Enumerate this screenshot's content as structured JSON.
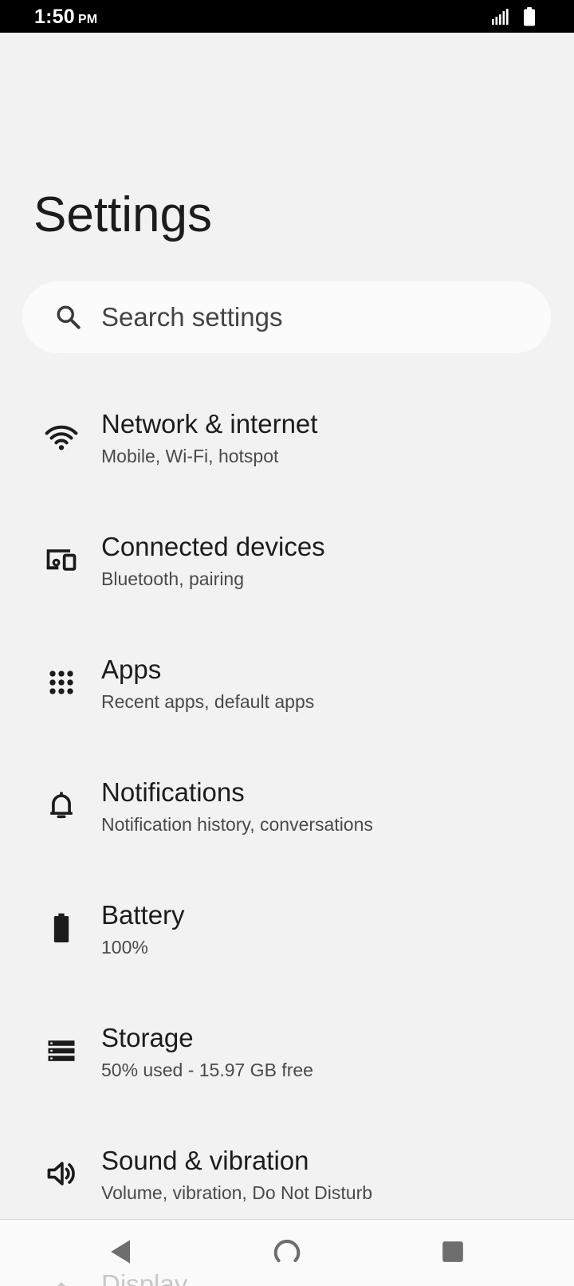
{
  "status_bar": {
    "time": "1:50",
    "ampm": "PM",
    "icons": [
      "signal-icon",
      "battery-full-icon"
    ]
  },
  "header": {
    "title": "Settings"
  },
  "search": {
    "placeholder": "Search settings",
    "icon": "search-icon"
  },
  "menu": {
    "items": [
      {
        "title": "Network & internet",
        "subtitle": "Mobile, Wi-Fi, hotspot",
        "icon": "wifi-icon"
      },
      {
        "title": "Connected devices",
        "subtitle": "Bluetooth, pairing",
        "icon": "connected-devices-icon"
      },
      {
        "title": "Apps",
        "subtitle": "Recent apps, default apps",
        "icon": "apps-grid-icon"
      },
      {
        "title": "Notifications",
        "subtitle": "Notification history, conversations",
        "icon": "bell-icon"
      },
      {
        "title": "Battery",
        "subtitle": "100%",
        "icon": "battery-icon"
      },
      {
        "title": "Storage",
        "subtitle": "50% used - 15.97 GB free",
        "icon": "storage-icon"
      },
      {
        "title": "Sound & vibration",
        "subtitle": "Volume, vibration, Do Not Disturb",
        "icon": "volume-icon"
      },
      {
        "title": "Display",
        "icon": "display-icon"
      }
    ]
  },
  "nav_bar": {
    "buttons": [
      "back-icon",
      "home-icon",
      "recents-icon"
    ]
  },
  "colors": {
    "background": "#f2f2f2",
    "status_bar": "#000000",
    "search_bg": "#fbfbfb",
    "text_primary": "#1c1c1c",
    "text_secondary": "#4a4a4a",
    "nav_icon": "#6e6e6e"
  }
}
